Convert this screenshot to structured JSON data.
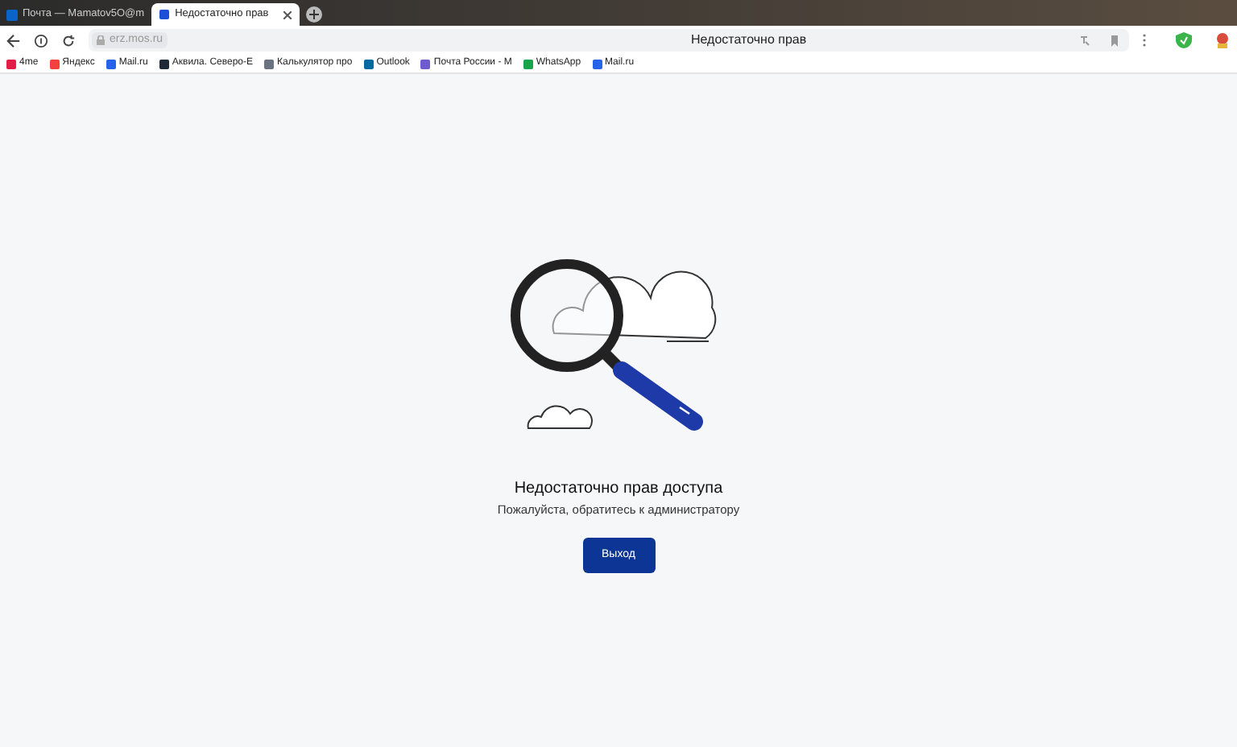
{
  "tabs": [
    {
      "label": "Почта — Mamatov5O@m",
      "selected": false
    },
    {
      "label": "Недостаточно прав",
      "selected": true
    }
  ],
  "toolbar": {
    "address": "erz.mos.ru",
    "page_title": "Недостаточно прав"
  },
  "bookmarks": [
    {
      "label": "4me",
      "color": "#e11d48"
    },
    {
      "label": "Яндекс",
      "color": "#f43f3f"
    },
    {
      "label": "Mail.ru",
      "color": "#2563eb"
    },
    {
      "label": "Аквила. Северо-Е",
      "color": "#1f2937"
    },
    {
      "label": "Калькулятор про",
      "color": "#6b7280"
    },
    {
      "label": "Outlook",
      "color": "#0369a1"
    },
    {
      "label": "Почта России - М",
      "color": "#6d5bd0"
    },
    {
      "label": "WhatsApp",
      "color": "#16a34a"
    },
    {
      "label": "Mail.ru",
      "color": "#2563eb"
    }
  ],
  "message": {
    "title": "Недостаточно прав доступа",
    "subtitle": "Пожалуйста, обратитесь к администратору",
    "button": "Выход"
  }
}
